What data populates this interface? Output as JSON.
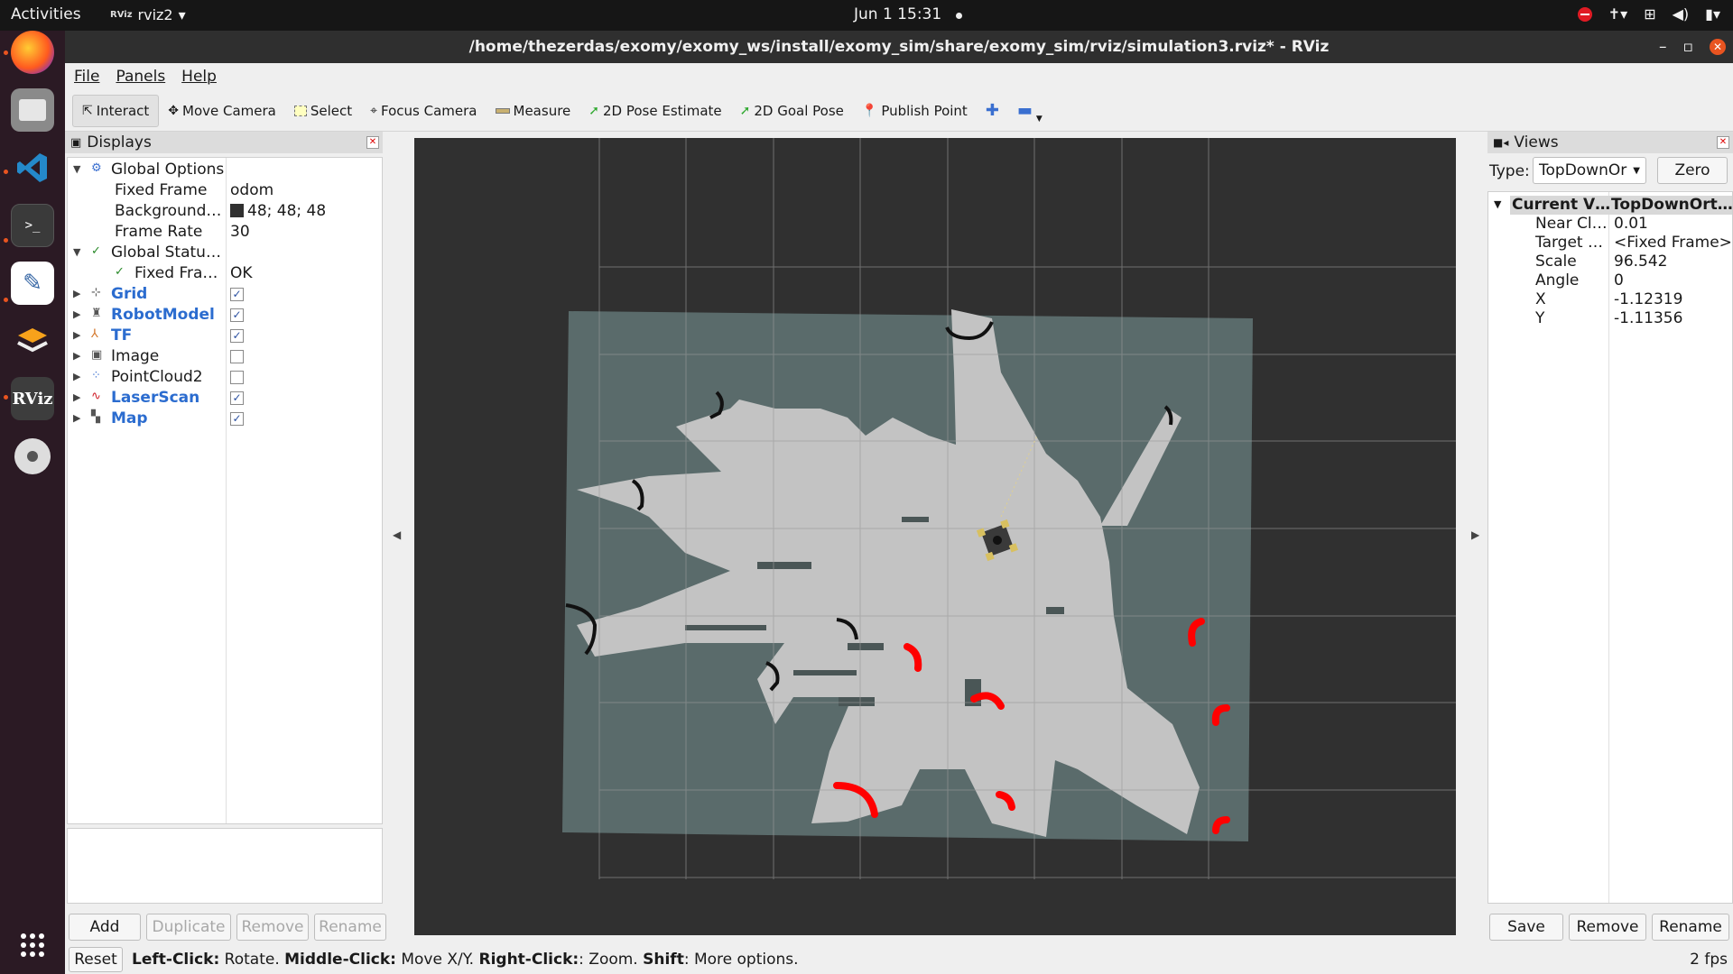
{
  "topbar": {
    "activities": "Activities",
    "app_name": "rviz2",
    "clock": "Jun 1  15:31"
  },
  "window": {
    "title": "/home/thezerdas/exomy/exomy_ws/install/exomy_sim/share/exomy_sim/rviz/simulation3.rviz* - RViz"
  },
  "menu": {
    "file": "File",
    "panels": "Panels",
    "help": "Help"
  },
  "toolbar": {
    "interact": "Interact",
    "move_camera": "Move Camera",
    "select": "Select",
    "focus_camera": "Focus Camera",
    "measure": "Measure",
    "pose_estimate": "2D Pose Estimate",
    "goal_pose": "2D Goal Pose",
    "publish_point": "Publish Point"
  },
  "displays": {
    "title": "Displays",
    "global_options": "Global Options",
    "fixed_frame_label": "Fixed Frame",
    "fixed_frame_value": "odom",
    "background_label": "Background…",
    "background_value": "48; 48; 48",
    "frame_rate_label": "Frame Rate",
    "frame_rate_value": "30",
    "global_status": "Global Statu…",
    "fixed_frame_status_label": "Fixed Fra…",
    "fixed_frame_status_value": "OK",
    "items": [
      {
        "label": "Grid",
        "checked": true
      },
      {
        "label": "RobotModel",
        "checked": true
      },
      {
        "label": "TF",
        "checked": true
      },
      {
        "label": "Image",
        "checked": false
      },
      {
        "label": "PointCloud2",
        "checked": false
      },
      {
        "label": "LaserScan",
        "checked": true
      },
      {
        "label": "Map",
        "checked": true
      }
    ],
    "buttons": {
      "add": "Add",
      "duplicate": "Duplicate",
      "remove": "Remove",
      "rename": "Rename"
    }
  },
  "views": {
    "title": "Views",
    "type_label": "Type:",
    "type_value": "TopDownOr",
    "zero": "Zero",
    "header_left": "Current V…",
    "header_right": "TopDownOrt…",
    "props": [
      {
        "label": "Near Cl…",
        "value": "0.01"
      },
      {
        "label": "Target …",
        "value": "<Fixed Frame>"
      },
      {
        "label": "Scale",
        "value": "96.542"
      },
      {
        "label": "Angle",
        "value": "0"
      },
      {
        "label": "X",
        "value": "-1.12319"
      },
      {
        "label": "Y",
        "value": "-1.11356"
      }
    ],
    "buttons": {
      "save": "Save",
      "remove": "Remove",
      "rename": "Rename"
    }
  },
  "statusbar": {
    "reset": "Reset",
    "left_key": "Left-Click:",
    "left_text": " Rotate. ",
    "middle_key": "Middle-Click:",
    "middle_text": " Move X/Y. ",
    "right_key": "Right-Click:",
    "right_text": ": Zoom. ",
    "shift_key": "Shift",
    "shift_text": ": More options.",
    "fps": "2 fps"
  },
  "colors": {
    "background": "#303030",
    "map_unknown": "#5a6b6b",
    "map_free": "#c3c3c3",
    "laser": "#ff0000",
    "accent": "#e95420"
  }
}
